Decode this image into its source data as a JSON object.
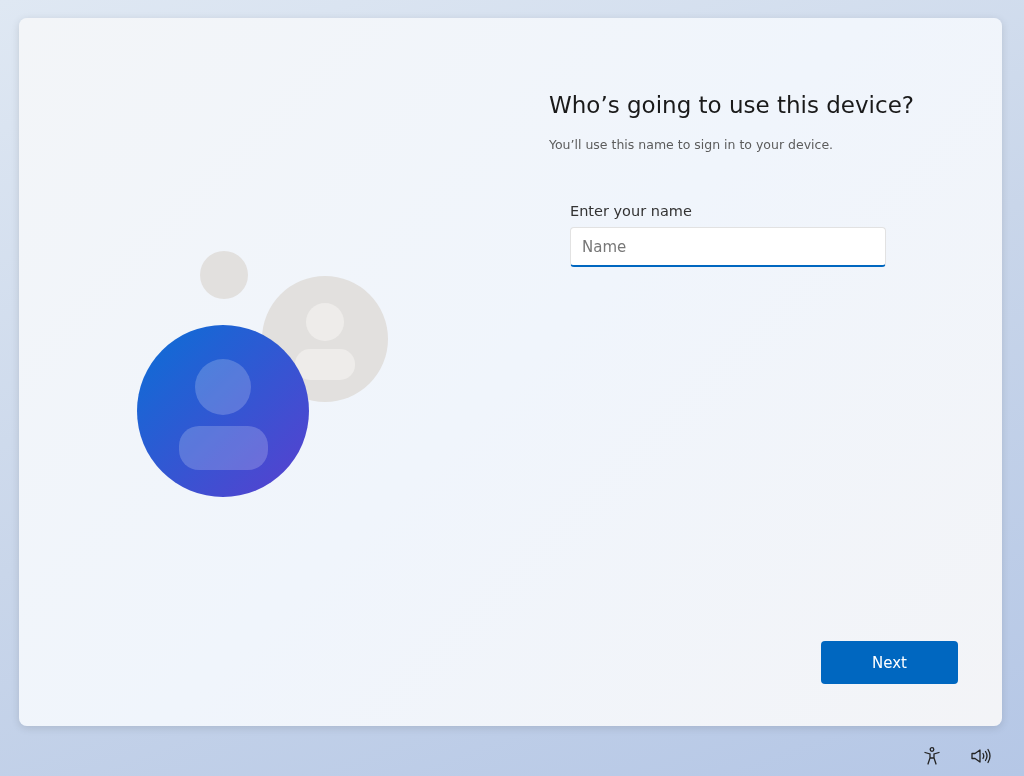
{
  "title": "Who’s going to use this device?",
  "subtitle": "You’ll use this name to sign in to your device.",
  "name_field": {
    "label": "Enter your name",
    "placeholder": "Name",
    "focused": true
  },
  "buttons": [
    {
      "label": "Next"
    }
  ]
}
